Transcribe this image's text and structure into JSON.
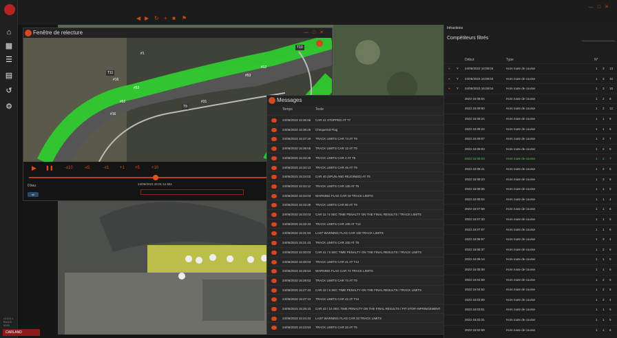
{
  "colors": {
    "accent": "#d2461e",
    "green_highlight": "#3ddc3d",
    "track_limit": "#39c93a"
  },
  "sidebar": {
    "icons": [
      "home-icon",
      "dashboard-icon",
      "list-icon",
      "chat-icon",
      "history-icon",
      "settings-icon"
    ],
    "version_lines": [
      "v1.6.0.1",
      "BUILD 0000"
    ],
    "brand_tag": "CARLAND"
  },
  "replay": {
    "title": "Fenêtre de relecture",
    "corner_labels": [
      "T10",
      "T9",
      "T11"
    ],
    "car_labels": [
      "#16",
      "#16",
      "#31",
      "#53",
      "#12",
      "#1",
      "#52",
      "#53"
    ],
    "controls": [
      "-x10",
      "-x5",
      "-x1",
      "+1",
      "+5",
      "+10"
    ],
    "timestamp": "24/06/2023 15:01:12.651",
    "footer_label": "0 lieu",
    "footer_badge": "x1"
  },
  "messages": {
    "title": "Messages",
    "col_time": "Temps",
    "col_text": "Texte",
    "rows": [
      {
        "t": "24/06/2023 15:36:55",
        "m": "CAR 41 STOPPED AT T7"
      },
      {
        "t": "24/06/2023 15:36:25",
        "m": "Chequered Flag"
      },
      {
        "t": "24/06/2023 15:37:19",
        "m": "TRACK LIMITS CAR 74 AT T9"
      },
      {
        "t": "24/06/2023 15:36:55",
        "m": "TRACK LIMITS CAR 12 AT T9"
      },
      {
        "t": "24/06/2023 15:33:35",
        "m": "TRACK LIMITS CAR 2 AT T5"
      },
      {
        "t": "24/06/2023 15:34:13",
        "m": "TRACK LIMITS CAR 45 AT T9"
      },
      {
        "t": "24/06/2023 15:34:02",
        "m": "CAR 40 (SPUN AND REJOINED) AT T5"
      },
      {
        "t": "24/06/2023 15:34:12",
        "m": "TRACK LIMITS CAR 130 AT T5"
      },
      {
        "t": "24/06/2023 15:34:03",
        "m": "WARNING FLAG CAR 18 TRACK LIMITS"
      },
      {
        "t": "24/06/2023 15:33:29",
        "m": "TRACK LIMITS CAR 90 AT T9"
      },
      {
        "t": "24/06/2023 15:33:03",
        "m": "CAR 11 / 5 SEC TIME PENALTY ON THE FINAL RESULTS / TRACK LIMITS"
      },
      {
        "t": "24/06/2023 15:32:43",
        "m": "TRACK LIMITS CAR 100 AT T12"
      },
      {
        "t": "24/06/2023 15:31:53",
        "m": "LAST WARNING FLAG CAR 100 TRACK LIMITS"
      },
      {
        "t": "24/06/2023 15:31:43",
        "m": "TRACK LIMITS CAR 100 AT T5"
      },
      {
        "t": "24/06/2023 15:30:03",
        "m": "CAR 41 / 5 SEC TIME PENALTY ON THE FINAL RESULTS / TRACK LIMITS"
      },
      {
        "t": "24/06/2023 15:30:03",
        "m": "TRACK LIMITS CAR 41 AT T12"
      },
      {
        "t": "24/06/2023 15:29:53",
        "m": "WARNING FLAG CAR 74 TRACK LIMITS"
      },
      {
        "t": "24/06/2023 15:28:53",
        "m": "TRACK LIMITS CAR 74 AT T9"
      },
      {
        "t": "24/06/2023 15:27:43",
        "m": "CAR 42 / 5 SEC TIME PENALTY ON THE FINAL RESULTS / TRACK LIMITS"
      },
      {
        "t": "24/06/2023 15:27:13",
        "m": "TRACK LIMITS CAR 42 AT T12"
      },
      {
        "t": "24/06/2023 15:26:33",
        "m": "CAR 42 / 10 SEC TIME PENALTY ON THE FINAL RESULTS / PIT STOP INFRINGEMENT"
      },
      {
        "t": "24/06/2023 15:24:43",
        "m": "LAST WARNING FLAG CAR 33 TRACK LIMITS"
      },
      {
        "t": "24/06/2023 15:23:53",
        "m": "TRACK LIMITS CAR 33 AT T5"
      }
    ]
  },
  "rpanel": {
    "title": "Infractions",
    "filter_label": "Compétiteurs filtrés",
    "col_debut": "Début",
    "col_type": "Type",
    "col_num": "N°",
    "rows": [
      {
        "d": "24/06/2023 16:08:04",
        "ty": "Hors route de course",
        "n": "1",
        "c": "3",
        "v": "13",
        "flag": "Y"
      },
      {
        "d": "24/06/2023 16:08:04",
        "ty": "Hors route de course",
        "n": "1",
        "c": "3",
        "v": "10",
        "flag": "Y"
      },
      {
        "d": "24/06/2023 16:08:04",
        "ty": "Hors route de course",
        "n": "1",
        "c": "3",
        "v": "10",
        "flag": "Y"
      },
      {
        "d": "2023 16:08:04",
        "ty": "Hors route de course",
        "n": "1",
        "c": "2",
        "v": "8",
        "flag": ""
      },
      {
        "d": "2023 16:09:50",
        "ty": "Hors route de course",
        "n": "1",
        "c": "2",
        "v": "12",
        "flag": ""
      },
      {
        "d": "2023 16:09:24",
        "ty": "Hors route de course",
        "n": "1",
        "c": "1",
        "v": "6",
        "flag": ""
      },
      {
        "d": "2023 16:09:24",
        "ty": "Hors route de course",
        "n": "1",
        "c": "1",
        "v": "5",
        "flag": ""
      },
      {
        "d": "2023 16:09:07",
        "ty": "Hors route de course",
        "n": "1",
        "c": "2",
        "v": "7",
        "flag": ""
      },
      {
        "d": "2023 16:08:03",
        "ty": "Hors route de course",
        "n": "1",
        "c": "2",
        "v": "6",
        "flag": ""
      },
      {
        "d": "2023 16:08:03",
        "ty": "Hors route de course",
        "n": "1",
        "c": "2",
        "v": "7",
        "flag": ""
      },
      {
        "d": "2023 16:08:41",
        "ty": "Hors route de course",
        "n": "1",
        "c": "2",
        "v": "5",
        "flag": ""
      },
      {
        "d": "2023 16:08:23",
        "ty": "Hors route de course",
        "n": "1",
        "c": "3",
        "v": "6",
        "flag": ""
      },
      {
        "d": "2023 16:08:05",
        "ty": "Hors route de course",
        "n": "1",
        "c": "1",
        "v": "5",
        "flag": ""
      },
      {
        "d": "2023 16:08:04",
        "ty": "Hors route de course",
        "n": "1",
        "c": "1",
        "v": "4",
        "flag": ""
      },
      {
        "d": "2023 16:07:59",
        "ty": "Hors route de course",
        "n": "1",
        "c": "1",
        "v": "6",
        "flag": ""
      },
      {
        "d": "2023 16:07:33",
        "ty": "Hors route de course",
        "n": "1",
        "c": "1",
        "v": "5",
        "flag": ""
      },
      {
        "d": "2023 16:07:07",
        "ty": "Hors route de course",
        "n": "1",
        "c": "1",
        "v": "6",
        "flag": ""
      },
      {
        "d": "2023 16:06:57",
        "ty": "Hors route de course",
        "n": "1",
        "c": "3",
        "v": "4",
        "flag": ""
      },
      {
        "d": "2023 16:06:37",
        "ty": "Hors route de course",
        "n": "1",
        "c": "2",
        "v": "6",
        "flag": ""
      },
      {
        "d": "2023 16:06:14",
        "ty": "Hors route de course",
        "n": "1",
        "c": "1",
        "v": "6",
        "flag": ""
      },
      {
        "d": "2023 16:05:08",
        "ty": "Hors route de course",
        "n": "1",
        "c": "1",
        "v": "5",
        "flag": ""
      },
      {
        "d": "2023 16:04:58",
        "ty": "Hors route de course",
        "n": "1",
        "c": "2",
        "v": "6",
        "flag": ""
      },
      {
        "d": "2023 16:04:52",
        "ty": "Hors route de course",
        "n": "1",
        "c": "2",
        "v": "5",
        "flag": ""
      },
      {
        "d": "2023 16:03:59",
        "ty": "Hors route de course",
        "n": "1",
        "c": "2",
        "v": "4",
        "flag": ""
      },
      {
        "d": "2023 16:03:51",
        "ty": "Hors route de course",
        "n": "1",
        "c": "1",
        "v": "5",
        "flag": ""
      },
      {
        "d": "2023 16:03:31",
        "ty": "Hors route de course",
        "n": "1",
        "c": "1",
        "v": "5",
        "flag": ""
      },
      {
        "d": "2023 16:02:59",
        "ty": "Hors route de course",
        "n": "1",
        "c": "1",
        "v": "6",
        "flag": ""
      }
    ],
    "highlight_index": 9
  }
}
